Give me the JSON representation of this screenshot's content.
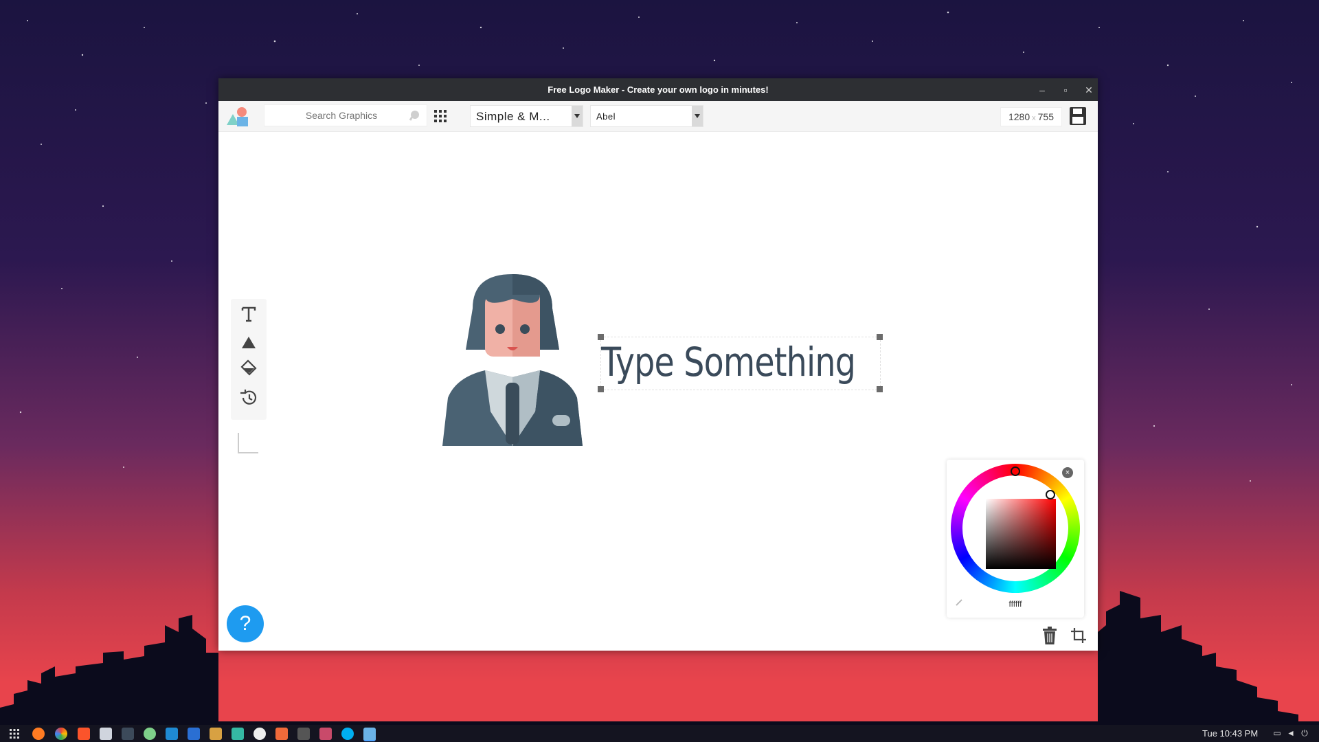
{
  "window": {
    "title": "Free Logo Maker - Create your own logo in minutes!",
    "minimize": "–",
    "maximize": "▫",
    "close": "✕"
  },
  "toolbar": {
    "search_placeholder": "Search Graphics",
    "style_selected": "Simple & M...",
    "font_selected": "Abel",
    "width": "1280",
    "dims_separator": "x",
    "height": "755"
  },
  "canvas": {
    "text": "Type Something"
  },
  "color_picker": {
    "hex": "ffffff",
    "close": "×"
  },
  "help": {
    "label": "?"
  },
  "taskbar": {
    "clock": "Tue 10:43 PM"
  },
  "colors": {
    "titlebar": "#2d2f33",
    "help_button": "#1e9bf0",
    "text_color": "#3a4a5a"
  }
}
